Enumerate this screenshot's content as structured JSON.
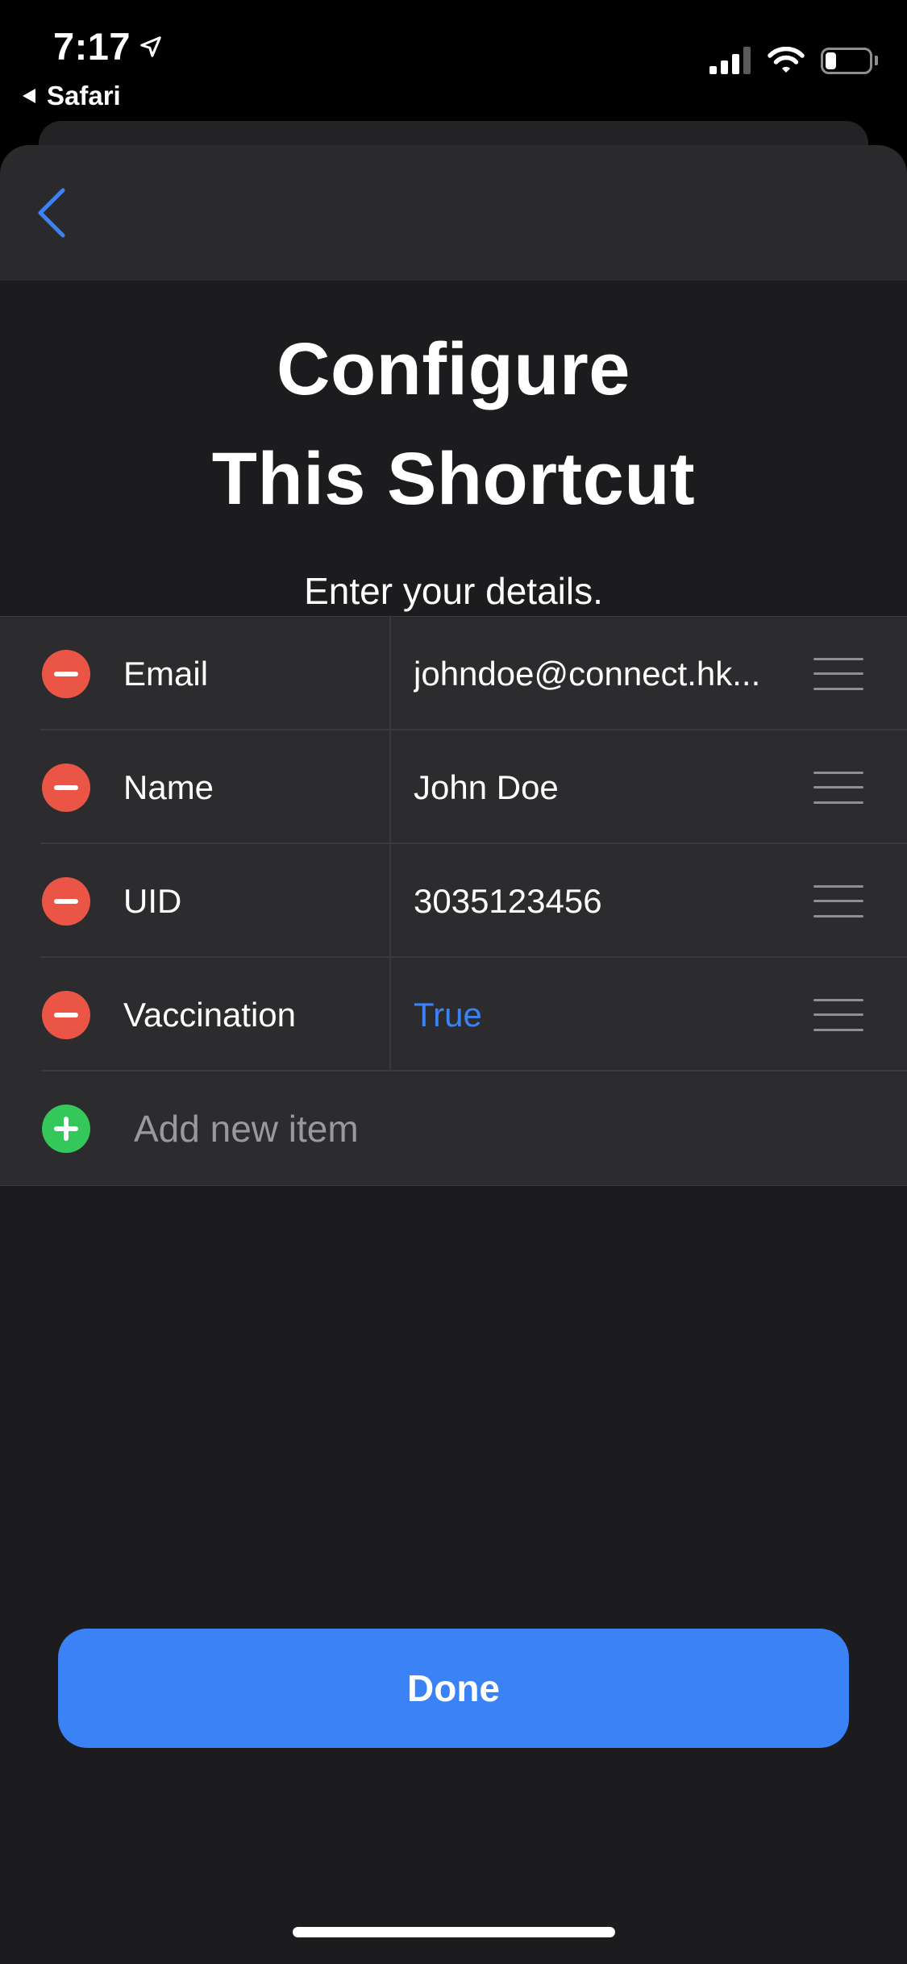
{
  "status_bar": {
    "time": "7:17",
    "back_app": "Safari",
    "location_icon": "location-arrow-icon",
    "signal_icon": "cellular-signal-icon",
    "wifi_icon": "wifi-icon",
    "battery_icon": "battery-icon",
    "battery_level": 0.25
  },
  "nav": {
    "back_icon": "chevron-left-icon"
  },
  "header": {
    "title_line1": "Configure",
    "title_line2": "This Shortcut",
    "subtitle": "Enter your details."
  },
  "items": [
    {
      "key": "Email",
      "value": "johndoe@connect.hk...",
      "value_is_accent": false
    },
    {
      "key": "Name",
      "value": "John Doe",
      "value_is_accent": false
    },
    {
      "key": "UID",
      "value": "3035123456",
      "value_is_accent": false
    },
    {
      "key": "Vaccination",
      "value": "True",
      "value_is_accent": true
    }
  ],
  "add_item": {
    "label": "Add new item"
  },
  "done_button": {
    "label": "Done"
  },
  "colors": {
    "accent": "#3b82f6",
    "remove": "#eb5545",
    "add": "#34c759",
    "sheet_background": "#1c1c1e",
    "list_background": "#2c2c2e"
  }
}
